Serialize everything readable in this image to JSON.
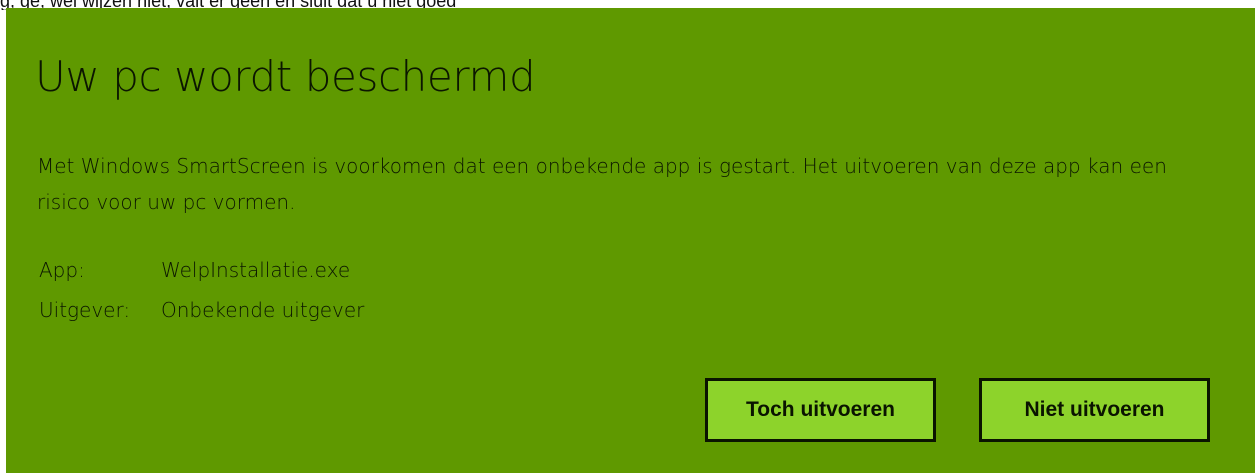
{
  "caption": "g, ge, wel wijzen niet, valt er geen en sluit dat u niet goed",
  "dialog": {
    "title": "Uw pc wordt beschermd",
    "message": "Met Windows SmartScreen is voorkomen dat een onbekende app is gestart. Het uitvoeren van deze app kan een risico voor uw pc vormen.",
    "details": [
      {
        "label": "App:",
        "value": "WelpInstallatie.exe"
      },
      {
        "label": "Uitgever:",
        "value": "Onbekende uitgever"
      }
    ],
    "buttons": {
      "run_anyway": "Toch uitvoeren",
      "dont_run": "Niet uitvoeren"
    }
  },
  "colors": {
    "dialog_background": "#5f9900",
    "button_background": "#8dd32b",
    "text_dark": "#0b1600"
  }
}
